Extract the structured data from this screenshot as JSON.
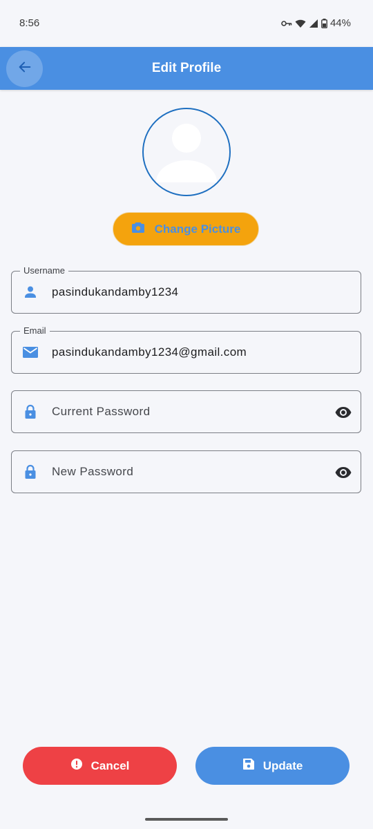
{
  "status_bar": {
    "time": "8:56",
    "battery": "44%",
    "icons": [
      "key-icon",
      "wifi-icon",
      "signal-icon",
      "battery-icon"
    ]
  },
  "app_bar": {
    "title": "Edit Profile",
    "back_icon": "arrow-left-icon"
  },
  "profile": {
    "avatar_icon": "person-placeholder-icon",
    "change_picture_label": "Change Picture",
    "change_picture_icon": "camera-icon"
  },
  "form": {
    "username": {
      "label": "Username",
      "value": "pasindukandamby1234",
      "icon": "person-icon"
    },
    "email": {
      "label": "Email",
      "value": "pasindukandamby1234@gmail.com",
      "icon": "mail-icon"
    },
    "current_password": {
      "placeholder": "Current Password",
      "icon": "lock-icon",
      "toggle_icon": "eye-icon"
    },
    "new_password": {
      "placeholder": "New Password",
      "icon": "lock-icon",
      "toggle_icon": "eye-icon"
    }
  },
  "actions": {
    "cancel_label": "Cancel",
    "cancel_icon": "alert-icon",
    "update_label": "Update",
    "update_icon": "save-icon"
  },
  "colors": {
    "primary": "#4a8fe2",
    "accent": "#f4a30d",
    "danger": "#ee4145",
    "background": "#f5f6fa"
  }
}
